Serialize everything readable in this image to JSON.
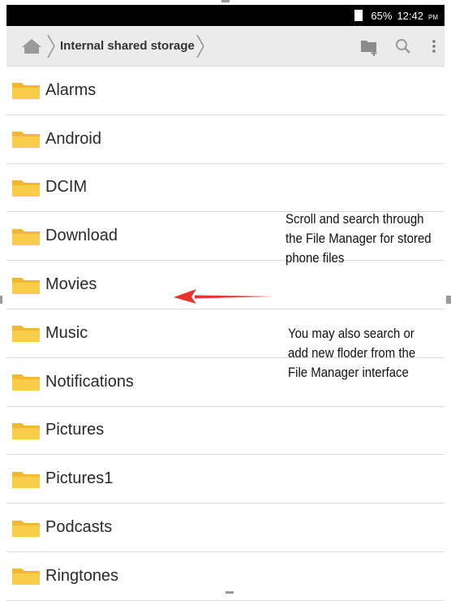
{
  "status_bar": {
    "battery_percent": "65%",
    "time": "12:42",
    "ampm": "PM"
  },
  "toolbar": {
    "home_icon": "home-icon",
    "breadcrumb": "Internal shared storage",
    "actions": [
      "new-folder-icon",
      "search-icon",
      "more-vert-icon"
    ]
  },
  "folders": [
    {
      "name": "Alarms"
    },
    {
      "name": "Android"
    },
    {
      "name": "DCIM"
    },
    {
      "name": "Download"
    },
    {
      "name": "Movies"
    },
    {
      "name": "Music"
    },
    {
      "name": "Notifications"
    },
    {
      "name": "Pictures"
    },
    {
      "name": "Pictures1"
    },
    {
      "name": "Podcasts"
    },
    {
      "name": "Ringtones"
    }
  ],
  "annotations": {
    "note_1": "Scroll and search through\nthe File Manager for stored\n phone files",
    "note_2": "You may also search or\nadd new floder from the\nFile Manager interface"
  },
  "colors": {
    "folder": "#f5c23a",
    "arrow": "#e8342f",
    "toolbar_bg": "#ebebeb"
  }
}
